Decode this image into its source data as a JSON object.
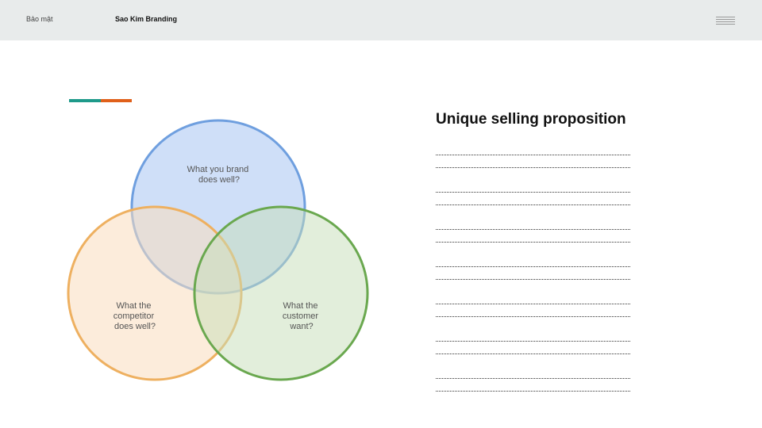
{
  "header": {
    "confidential": "Bảo mật",
    "brand": "Sao Kim Branding",
    "menu_icon": "hamburger-icon"
  },
  "accent_bar": {
    "colors": [
      "#1e9a8a",
      "#e0601a"
    ]
  },
  "venn": {
    "circles": [
      {
        "id": "brand",
        "lines": [
          "What you brand",
          "does well?"
        ],
        "fill": "#c7d9f7",
        "stroke": "#6f9fdf"
      },
      {
        "id": "competitor",
        "lines": [
          "What the",
          "competitor",
          "does well?"
        ],
        "fill": "#f9dcbd",
        "stroke": "#eeb060"
      },
      {
        "id": "customer",
        "lines": [
          "What the",
          "customer",
          "want?"
        ],
        "fill": "#c5ddb8",
        "stroke": "#6aa84f"
      }
    ]
  },
  "usp": {
    "title": "Unique selling proposition",
    "line_pairs": 7
  }
}
